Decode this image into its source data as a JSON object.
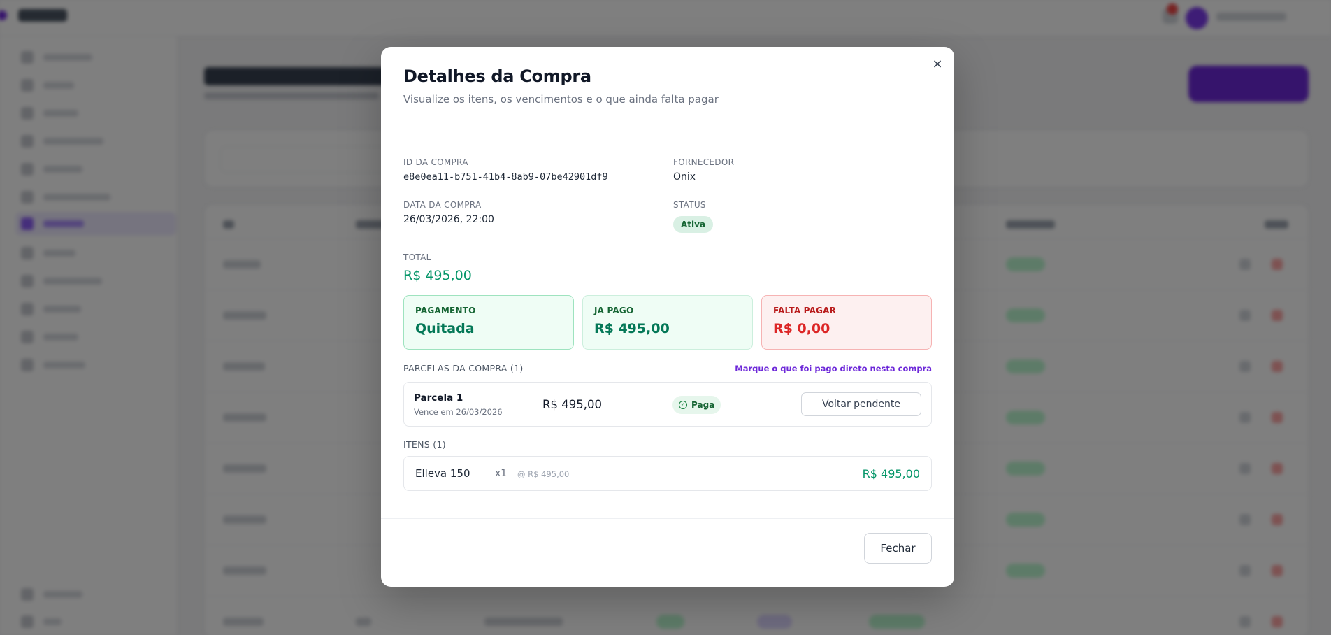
{
  "modal": {
    "title": "Detalhes da Compra",
    "subtitle": "Visualize os itens, os vencimentos e o que ainda falta pagar",
    "close_icon": "×",
    "fields": {
      "id_label": "ID DA COMPRA",
      "id_value": "e8e0ea11-b751-41b4-8ab9-07be42901df9",
      "supplier_label": "FORNECEDOR",
      "supplier_value": "Onix",
      "date_label": "DATA DA COMPRA",
      "date_value": "26/03/2026, 22:00",
      "status_label": "STATUS",
      "status_value": "Ativa",
      "total_label": "TOTAL",
      "total_value": "R$ 495,00"
    },
    "summary": [
      {
        "label": "PAGAMENTO",
        "value": "Quitada"
      },
      {
        "label": "JA PAGO",
        "value": "R$ 495,00"
      },
      {
        "label": "FALTA PAGAR",
        "value": "R$ 0,00"
      }
    ],
    "installments": {
      "section_label": "PARCELAS DA COMPRA (1)",
      "hint": "Marque o que foi pago direto nesta compra",
      "items": [
        {
          "name": "Parcela 1",
          "due": "Vence em 26/03/2026",
          "amount": "R$ 495,00",
          "status": "Paga",
          "action": "Voltar pendente"
        }
      ]
    },
    "items": {
      "section_label": "ITENS (1)",
      "list": [
        {
          "name": "Elleva 150",
          "qty": "x1",
          "unit": "@ R$ 495,00",
          "total": "R$ 495,00"
        }
      ]
    },
    "footer": {
      "close_label": "Fechar"
    }
  },
  "colors": {
    "accent": "#6d28d9",
    "money_green": "#059669",
    "danger_red": "#dc2626",
    "overlay": "rgba(0,0,0,0.5)"
  },
  "icons": {
    "close": "close-icon",
    "paid": "check-circle-icon"
  }
}
